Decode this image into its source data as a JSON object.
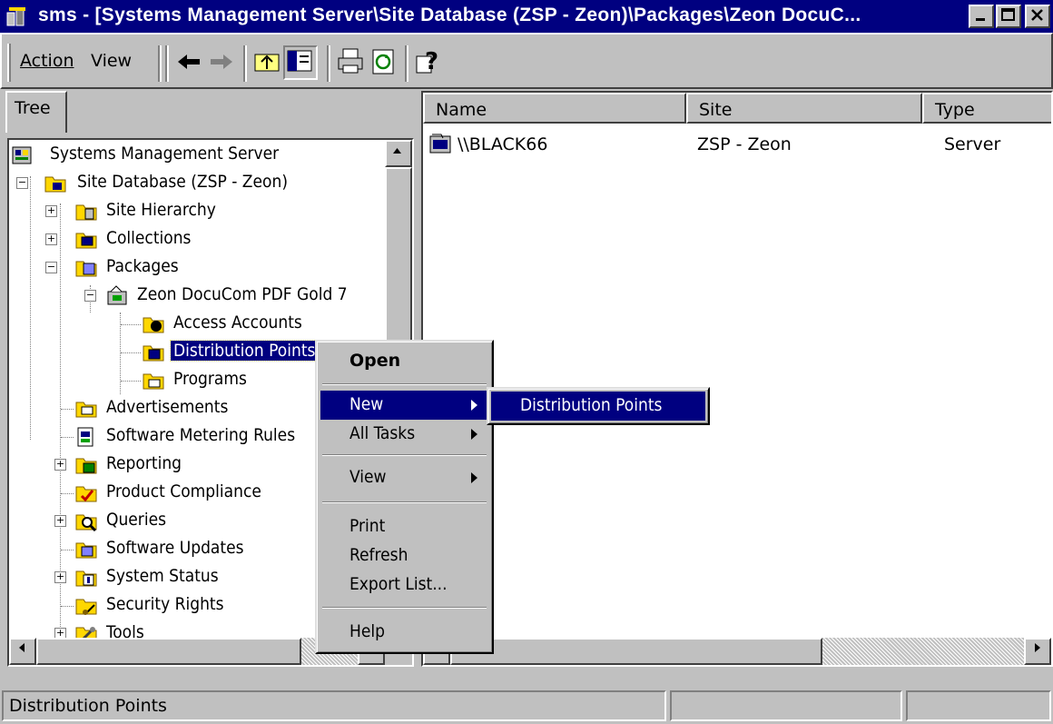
{
  "window": {
    "title": "sms - [Systems Management Server\\Site Database (ZSP - Zeon)\\Packages\\Zeon DocuC..."
  },
  "menu": {
    "action": "Action",
    "view": "View"
  },
  "tabs": {
    "tree": "Tree"
  },
  "tree": {
    "items": [
      {
        "label": "Systems Management Server"
      },
      {
        "label": "Site Database (ZSP - Zeon)"
      },
      {
        "label": "Site Hierarchy"
      },
      {
        "label": "Collections"
      },
      {
        "label": "Packages"
      },
      {
        "label": "Zeon DocuCom PDF Gold 7"
      },
      {
        "label": "Access Accounts"
      },
      {
        "label": "Distribution Points"
      },
      {
        "label": "Programs"
      },
      {
        "label": "Advertisements"
      },
      {
        "label": "Software Metering Rules"
      },
      {
        "label": "Reporting"
      },
      {
        "label": "Product Compliance"
      },
      {
        "label": "Queries"
      },
      {
        "label": "Software Updates"
      },
      {
        "label": "System Status"
      },
      {
        "label": "Security Rights"
      },
      {
        "label": "Tools"
      }
    ]
  },
  "list": {
    "columns": {
      "name": "Name",
      "site": "Site",
      "type": "Type"
    },
    "rows": [
      {
        "name": "\\\\BLACK66",
        "site": "ZSP - Zeon",
        "type": "Server"
      }
    ]
  },
  "context_menu": {
    "open": "Open",
    "new": "New",
    "all_tasks": "All Tasks",
    "view": "View",
    "print": "Print",
    "refresh": "Refresh",
    "export_list": "Export List...",
    "help": "Help"
  },
  "submenu": {
    "distribution_points": "Distribution Points"
  },
  "status": {
    "text": "Distribution Points"
  },
  "colors": {
    "titlebar": "#000080",
    "selection": "#000080",
    "face": "#c0c0c0"
  }
}
